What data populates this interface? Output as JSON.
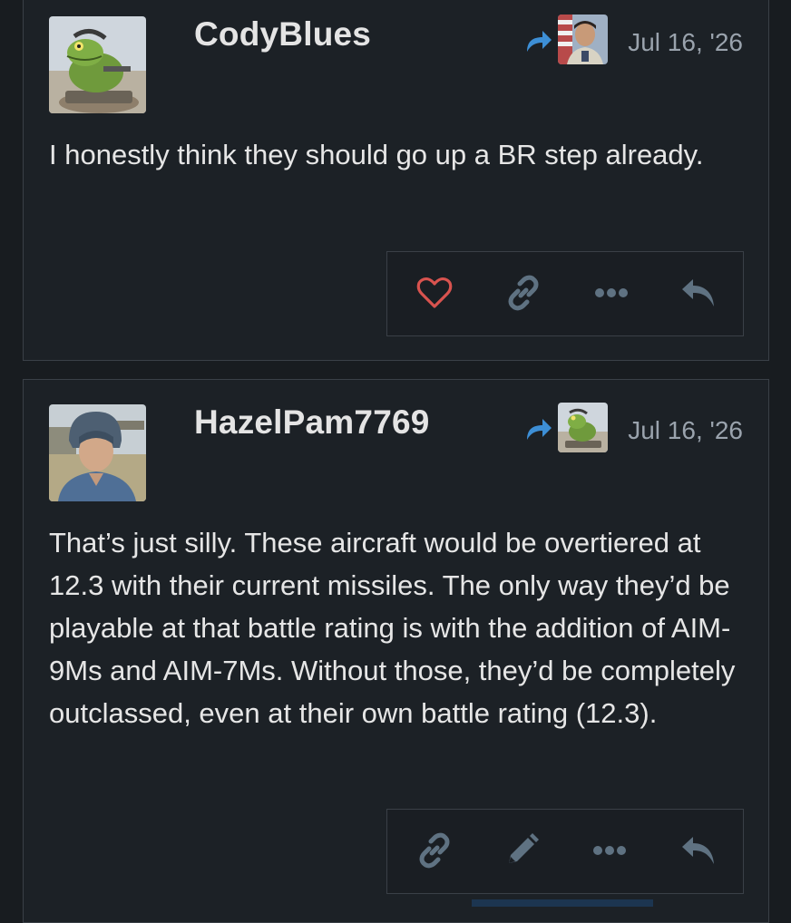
{
  "posts": [
    {
      "username": "CodyBlues",
      "avatar": "frog-tank-commander-avatar",
      "reply_to_avatar": "soldier-portrait-avatar",
      "date": "Jul 16, '26",
      "body": "I honestly think they should go up a BR step already.",
      "actions": [
        "heart-icon",
        "link-icon",
        "more-icon",
        "reply-icon"
      ]
    },
    {
      "username": "HazelPam7769",
      "avatar": "tank-crewman-avatar",
      "reply_to_avatar": "frog-tank-commander-avatar",
      "date": "Jul 16, '26",
      "body": "That’s just silly. These aircraft would be overtiered at 12.3 with their current missiles. The only way they’d be playable at that battle rating is with the addition of AIM-9Ms and AIM-7Ms. Without those, they’d be completely outclassed, even at their own battle rating (12.3).",
      "actions": [
        "link-icon",
        "pencil-icon",
        "more-icon",
        "reply-icon"
      ]
    }
  ],
  "colors": {
    "background": "#181c20",
    "card": "#1c2126",
    "border": "#3a4047",
    "text": "#e6e6e6",
    "muted": "#9aa3ad",
    "icon": "#5f7282",
    "heart": "#d9534f",
    "reply_arrow": "#3d8fd6"
  }
}
